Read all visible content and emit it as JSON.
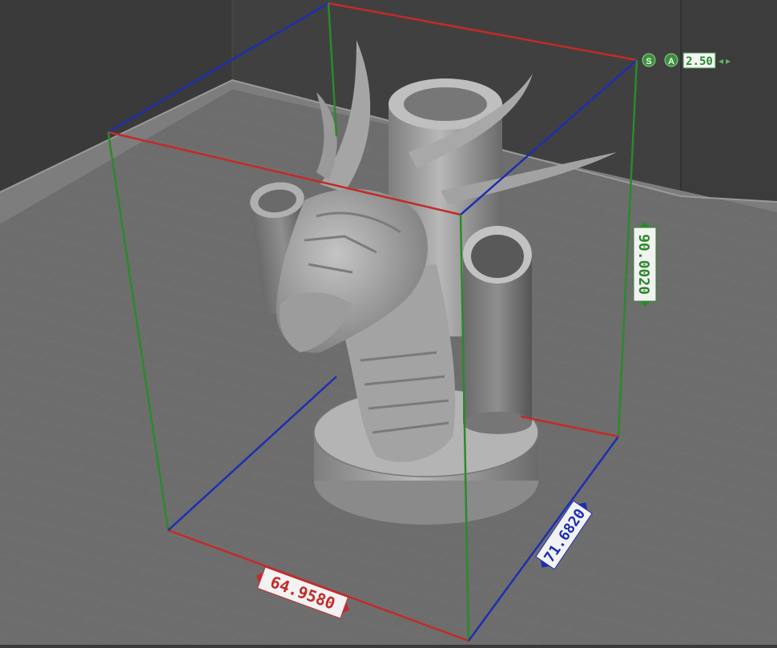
{
  "viewport": {
    "label": "3d-viewport"
  },
  "scene": {
    "model_icon": "dragon-pen-holder-model",
    "colors": {
      "x_axis": "#c42a2a",
      "y_axis": "#1c2fb0",
      "z_axis": "#2a8a2a",
      "floor": "#6e6e6e",
      "wall": "#5a5a5a",
      "model": "#a9a9a9"
    }
  },
  "dimensions": {
    "width": "64.9580",
    "depth": "71.6820",
    "height": "90.0020"
  },
  "snap_toolbar": {
    "snap_icon": "S",
    "angle_icon": "A",
    "step_value": "2.50",
    "left_arrow": "◂",
    "right_arrow": "▸"
  }
}
